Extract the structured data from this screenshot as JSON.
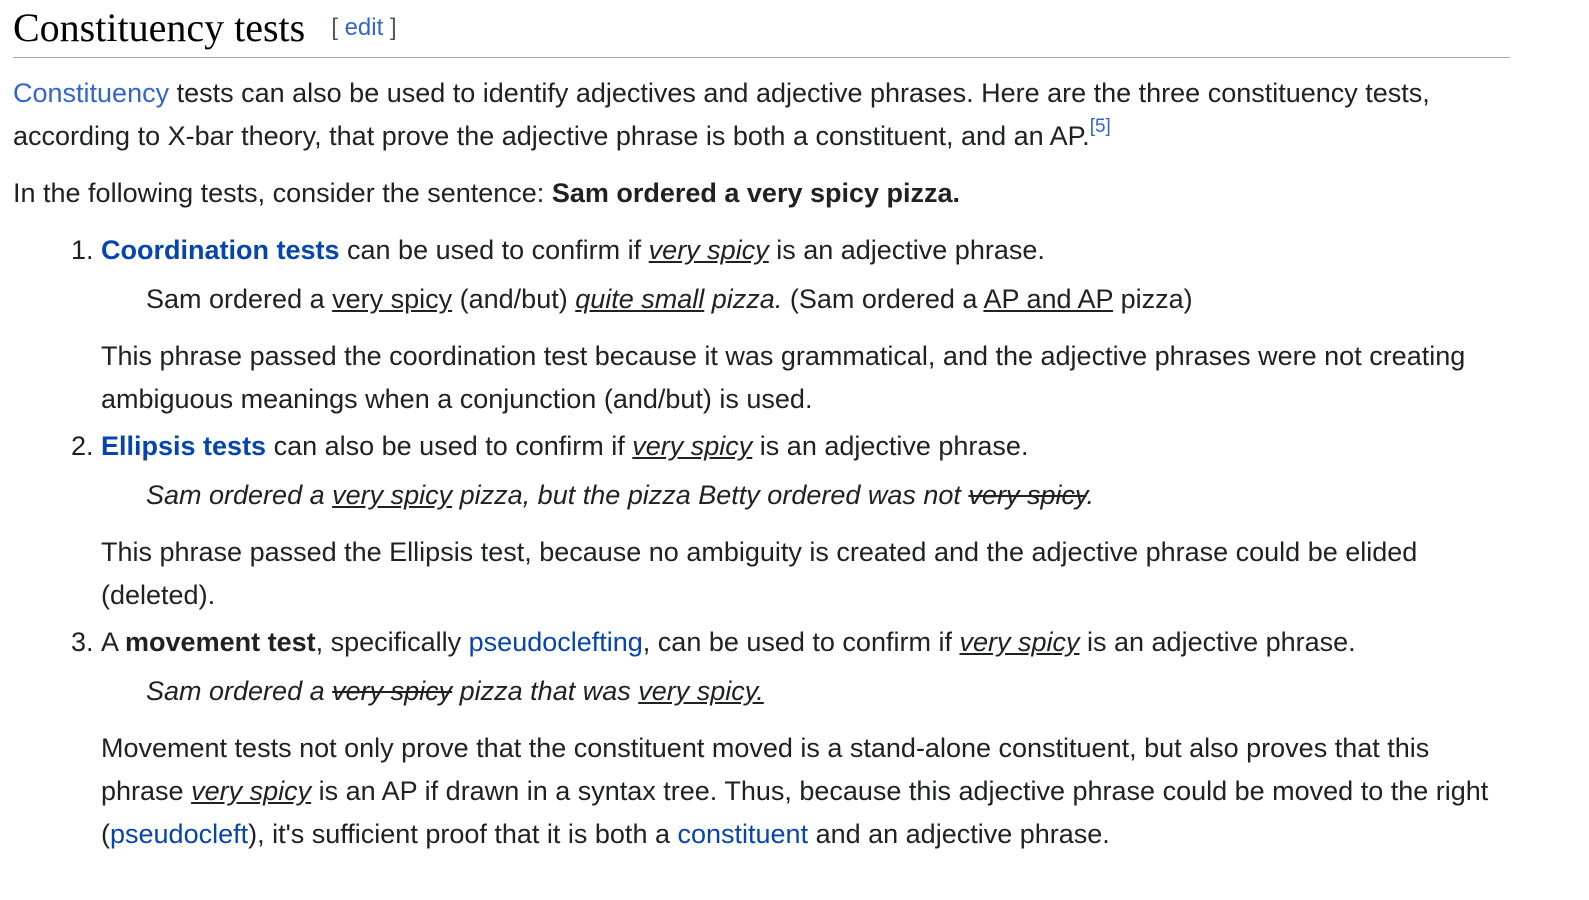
{
  "heading": {
    "title": "Constituency tests",
    "edit_open": "[",
    "edit_label": "edit",
    "edit_close": "]"
  },
  "intro": {
    "link_constituency": "Constituency",
    "text_a": " tests can also be used to identify adjectives and adjective phrases. Here are the three constituency tests, according to X-bar theory, that prove the adjective phrase is both a constituent, and an AP.",
    "ref": "[5]"
  },
  "sentence": {
    "lead": "In the following tests, consider the sentence: ",
    "bold": "Sam ordered a very spicy pizza."
  },
  "tests": [
    {
      "link": "Coordination tests",
      "text_a": " can be used to confirm if ",
      "ital": "very spicy",
      "text_b": " is an adjective phrase.",
      "ex_a": "Sam ordered a ",
      "ex_u1": "very spicy",
      "ex_b": " (and/but) ",
      "ex_u2": "quite small",
      "ex_c": " pizza.",
      "ex_d": " (Sam ordered a ",
      "ex_u3": "AP and AP",
      "ex_e": " pizza)",
      "expl": "This phrase passed the coordination test because it was grammatical, and the adjective phrases were not creating ambiguous meanings when a conjunction (and/but) is used."
    },
    {
      "link": "Ellipsis tests",
      "text_a": " can also be used to confirm if ",
      "ital": "very spicy",
      "text_b": " is an adjective phrase.",
      "ex_a": "Sam ordered a ",
      "ex_u1": "very spicy",
      "ex_b": " pizza, but the pizza Betty ordered was not ",
      "ex_s1": "very spicy",
      "ex_c": ".",
      "expl": "This phrase passed the Ellipsis test, because no ambiguity is created and the adjective phrase could be elided (deleted)."
    },
    {
      "lead": "A ",
      "bold": "movement test",
      "text_a": ", specifically ",
      "link": "pseudoclefting",
      "text_b": ", can be used to confirm if ",
      "ital": "very spicy",
      "text_c": " is an adjective phrase.",
      "ex_a": "Sam ordered a ",
      "ex_s1": "very spicy",
      "ex_b": " pizza that was ",
      "ex_u1": "very spicy.",
      "expl_a": "Movement tests not only prove that the constituent moved is a stand-alone constituent, but also proves that this phrase ",
      "expl_u": "very spicy",
      "expl_b": " is an AP if drawn in a syntax tree. Thus, because this adjective phrase could be moved to the right (",
      "expl_link1": "pseudocleft",
      "expl_c": "), it's sufficient proof that it is both a ",
      "expl_link2": "constituent",
      "expl_d": " and an adjective phrase."
    }
  ],
  "colors": {
    "text": "#202122",
    "link": "#3366cc",
    "link_bold": "#0645ad",
    "rule": "#a2a9b1"
  }
}
